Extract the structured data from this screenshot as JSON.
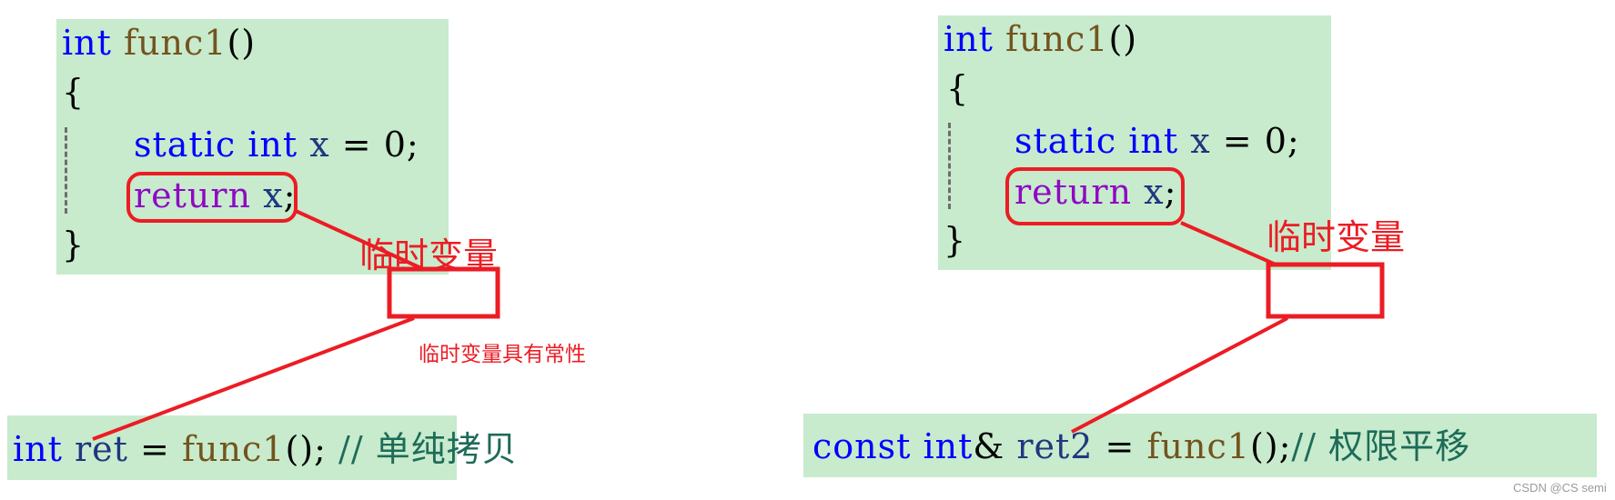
{
  "colors": {
    "background": "#ffffff",
    "code_background": "#c7ebcc",
    "keyword": "#0000ff",
    "function_name": "#74531f",
    "variable": "#1f377f",
    "control_keyword": "#8f08c4",
    "comment": "#1e6b59",
    "annotation_red": "#ec1c24"
  },
  "left_panel": {
    "function_code": {
      "line1": {
        "type": "int",
        "name": "func1",
        "parens": "()"
      },
      "open_brace": "{",
      "line3": {
        "static": "static",
        "type": "int",
        "var": "x",
        "eq": "=",
        "value": "0",
        "semi": ";"
      },
      "line4": {
        "keyword": "return",
        "var": "x",
        "semi": ";"
      },
      "close_brace": "}"
    },
    "temp_label": "临时变量",
    "const_note": "临时变量具有常性",
    "call_line": {
      "type": "int",
      "var": "ret",
      "eq": "=",
      "fn": "func1",
      "parens": "()",
      "semi": ";",
      "comment": "// 单纯拷贝"
    }
  },
  "right_panel": {
    "function_code": {
      "line1": {
        "type": "int",
        "name": "func1",
        "parens": "()"
      },
      "open_brace": "{",
      "line3": {
        "static": "static",
        "type": "int",
        "var": "x",
        "eq": "=",
        "value": "0",
        "semi": ";"
      },
      "line4": {
        "keyword": "return",
        "var": "x",
        "semi": ";"
      },
      "close_brace": "}"
    },
    "temp_label": "临时变量",
    "call_line": {
      "const": "const",
      "type": "int",
      "amp": "&",
      "var": "ret2",
      "eq": "=",
      "fn": "func1",
      "parens": "()",
      "semi": ";",
      "comment": "// 权限平移"
    }
  },
  "watermark": "CSDN @CS semi"
}
